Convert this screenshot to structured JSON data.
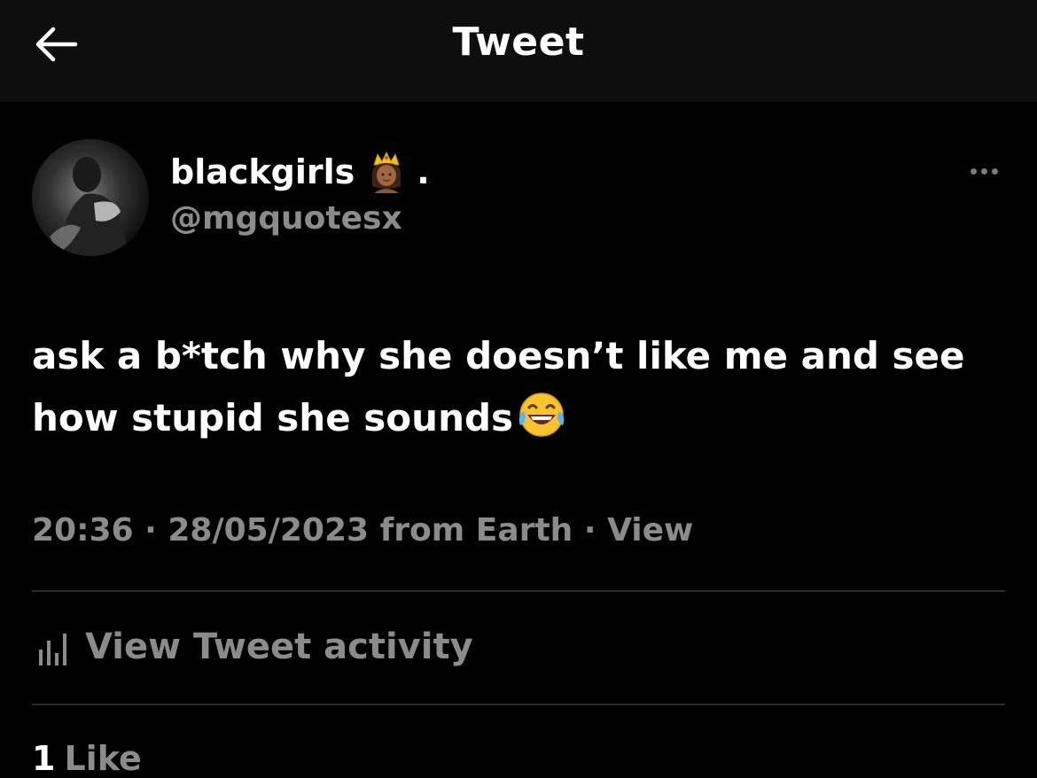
{
  "header": {
    "title": "Tweet",
    "back_icon": "arrow-left-icon"
  },
  "author": {
    "name": "blackgirls",
    "name_suffix": ".",
    "handle": "@mgquotesx",
    "badge_icon": "princess-emoji-icon"
  },
  "tweet": {
    "line1": "ask a b*tch why she doesn’t like me and see",
    "line2": "how stupid she sounds",
    "emoji": "face-with-tears-of-joy-icon"
  },
  "meta": {
    "time": "20:36",
    "separator": "·",
    "date": "28/05/2023",
    "source": "from Earth",
    "view": "View"
  },
  "activity": {
    "label": "View Tweet activity",
    "icon": "bar-chart-icon"
  },
  "likes": {
    "count": "1",
    "label": "Like"
  },
  "colors": {
    "background": "#000000",
    "header_bg": "#0e0e0e",
    "text": "#ffffff",
    "secondary_text": "#8b8b8b",
    "divider": "#2a2a2a"
  }
}
